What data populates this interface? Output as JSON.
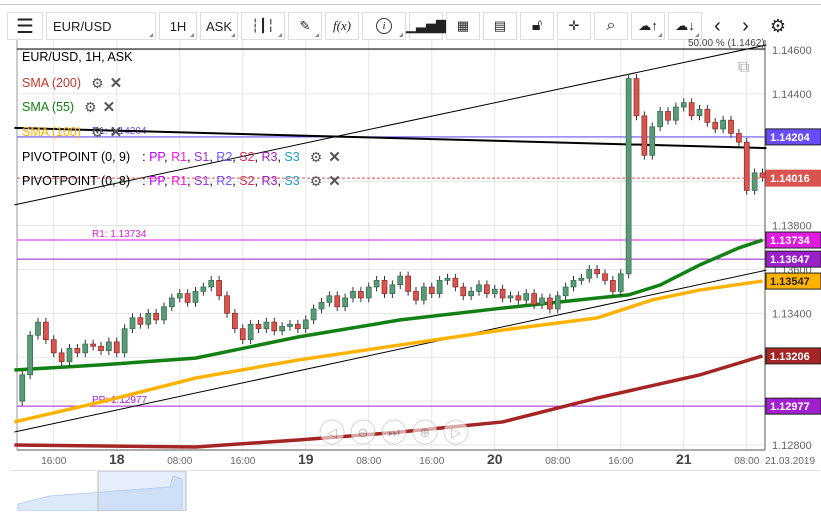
{
  "toolbar": {
    "menu_icon": "hamburger-icon",
    "symbol": "EUR/USD",
    "timeframe": "1H",
    "price_type": "ASK",
    "icons": [
      "candles-icon",
      "pencil-icon",
      "function-icon",
      "info-icon",
      "bar-chart-icon",
      "calendar-icon",
      "news-icon",
      "lock-icon",
      "crosshair-icon",
      "zoom-icon",
      "upload-cloud-icon",
      "download-cloud-icon",
      "chevron-left-icon",
      "chevron-right-icon",
      "gear-icon"
    ],
    "function_label": "f(x)"
  },
  "legend": {
    "title": "EUR/USD, 1H, ASK",
    "sma200": "SMA (200)",
    "sma55": "SMA (55)",
    "sma100": "SMA (100)",
    "pivot1": "PIVOTPOINT (0, 9)",
    "pivot2": "PIVOTPOINT (0, 8)",
    "pivot_parts": [
      {
        "t": "PP",
        "c": "#c000ff"
      },
      {
        "t": "R1",
        "c": "#ff1ad9"
      },
      {
        "t": "S1",
        "c": "#9b30d9"
      },
      {
        "t": "R2",
        "c": "#6a5cff"
      },
      {
        "t": "S2",
        "c": "#d62f5a"
      },
      {
        "t": "R3",
        "c": "#a020c0"
      },
      {
        "t": "S3",
        "c": "#1fa0c0"
      }
    ]
  },
  "fib_label": "50.00 % (1.1462)",
  "chart_data": {
    "type": "candlestick",
    "start": "2019-03-17 12:00",
    "interval_hours": 1,
    "first_open": 1.13,
    "close": [
      1.1312,
      1.133,
      1.1336,
      1.1328,
      1.1322,
      1.1318,
      1.1324,
      1.1322,
      1.1326,
      1.1325,
      1.1323,
      1.1327,
      1.1322,
      1.1333,
      1.1338,
      1.1335,
      1.134,
      1.1337,
      1.1343,
      1.1347,
      1.1349,
      1.1345,
      1.135,
      1.1352,
      1.1355,
      1.1348,
      1.134,
      1.1333,
      1.1328,
      1.1335,
      1.1333,
      1.1336,
      1.1332,
      1.1334,
      1.1335,
      1.1333,
      1.1337,
      1.1342,
      1.1345,
      1.1348,
      1.1343,
      1.1347,
      1.135,
      1.1347,
      1.1352,
      1.1355,
      1.1349,
      1.1353,
      1.1357,
      1.135,
      1.1346,
      1.1352,
      1.1349,
      1.1355,
      1.1356,
      1.1352,
      1.1348,
      1.135,
      1.1353,
      1.1349,
      1.1351,
      1.1347,
      1.1348,
      1.1346,
      1.1349,
      1.1344,
      1.1347,
      1.1342,
      1.1348,
      1.1352,
      1.1355,
      1.1356,
      1.136,
      1.1358,
      1.1355,
      1.135,
      1.1358,
      1.1447,
      1.143,
      1.1412,
      1.1425,
      1.1432,
      1.1428,
      1.1434,
      1.1436,
      1.143,
      1.1433,
      1.1427,
      1.1424,
      1.1428,
      1.1422,
      1.1418,
      1.1396,
      1.1404,
      1.1402
    ],
    "ylim": [
      1.128,
      1.146
    ],
    "y_ticks": [
      1.128,
      1.13,
      1.132,
      1.134,
      1.136,
      1.138,
      1.14,
      1.142,
      1.144,
      1.146
    ],
    "x_ticks": [
      {
        "t": "2019-03-17 16:00",
        "label": "16:00",
        "bold": false
      },
      {
        "t": "2019-03-18 00:00",
        "label": "18",
        "bold": true
      },
      {
        "t": "2019-03-18 08:00",
        "label": "08:00",
        "bold": false
      },
      {
        "t": "2019-03-18 16:00",
        "label": "16:00",
        "bold": false
      },
      {
        "t": "2019-03-19 00:00",
        "label": "19",
        "bold": true
      },
      {
        "t": "2019-03-19 08:00",
        "label": "08:00",
        "bold": false
      },
      {
        "t": "2019-03-19 16:00",
        "label": "16:00",
        "bold": false
      },
      {
        "t": "2019-03-20 00:00",
        "label": "20",
        "bold": true
      },
      {
        "t": "2019-03-20 08:00",
        "label": "08:00",
        "bold": false
      },
      {
        "t": "2019-03-20 16:00",
        "label": "16:00",
        "bold": false
      },
      {
        "t": "2019-03-21 00:00",
        "label": "21",
        "bold": true
      },
      {
        "t": "2019-03-21 08:00",
        "label": "08:00",
        "bold": false
      }
    ],
    "date_label": "21.03.2019",
    "series": [
      {
        "name": "SMA (200)",
        "color": "#a52424",
        "points": [
          [
            "2019-03-17 11:00",
            1.128
          ],
          [
            "2019-03-18 10:00",
            1.12791
          ],
          [
            "2019-03-18 23:00",
            1.12823
          ],
          [
            "2019-03-19 12:00",
            1.12859
          ],
          [
            "2019-03-20 01:00",
            1.12905
          ],
          [
            "2019-03-20 13:00",
            1.13014
          ],
          [
            "2019-03-21 02:00",
            1.13119
          ],
          [
            "2019-03-21 10:00",
            1.13206
          ]
        ],
        "last": "1.13206"
      },
      {
        "name": "SMA (100)",
        "color": "#ffb300",
        "points": [
          [
            "2019-03-17 11:00",
            1.12905
          ],
          [
            "2019-03-17 22:00",
            1.12996
          ],
          [
            "2019-03-18 10:00",
            1.13105
          ],
          [
            "2019-03-18 23:00",
            1.13187
          ],
          [
            "2019-03-19 12:00",
            1.13256
          ],
          [
            "2019-03-20 01:00",
            1.13324
          ],
          [
            "2019-03-20 13:00",
            1.13379
          ],
          [
            "2019-03-20 20:00",
            1.13461
          ],
          [
            "2019-03-21 02:00",
            1.13506
          ],
          [
            "2019-03-21 10:00",
            1.13547
          ]
        ],
        "last": "1.13547"
      },
      {
        "name": "SMA (55)",
        "color": "#128012",
        "points": [
          [
            "2019-03-17 11:00",
            1.13142
          ],
          [
            "2019-03-17 22:00",
            1.13165
          ],
          [
            "2019-03-18 10:00",
            1.13196
          ],
          [
            "2019-03-18 23:00",
            1.13292
          ],
          [
            "2019-03-19 12:00",
            1.1337
          ],
          [
            "2019-03-20 01:00",
            1.13424
          ],
          [
            "2019-03-20 13:00",
            1.1347
          ],
          [
            "2019-03-20 17:00",
            1.13484
          ],
          [
            "2019-03-20 21:00",
            1.13529
          ],
          [
            "2019-03-21 02:00",
            1.1362
          ],
          [
            "2019-03-21 07:00",
            1.13698
          ],
          [
            "2019-03-21 10:00",
            1.13734
          ]
        ]
      }
    ],
    "trendlines": [
      {
        "from": [
          "2019-03-17 11:00",
          1.13894
        ],
        "to": [
          "2019-03-21 10:30",
          1.14623
        ],
        "width": 1
      },
      {
        "from": [
          "2019-03-17 11:00",
          1.14245
        ],
        "to": [
          "2019-03-21 10:30",
          1.14153
        ],
        "width": 2
      },
      {
        "from": [
          "2019-03-17 11:00",
          1.12859
        ],
        "to": [
          "2019-03-21 10:30",
          1.13597
        ],
        "width": 1
      }
    ],
    "levels": [
      {
        "value": 1.14204,
        "label": "1.14204",
        "line_label": "R1: 1.14204",
        "color": "#6a4cff"
      },
      {
        "value": 1.13734,
        "label": "1.13734",
        "line_label": "R1: 1.13734",
        "color": "#e01be0"
      },
      {
        "value": 1.13647,
        "label": "1.13647",
        "line_label": "",
        "color": "#9b1fc9"
      },
      {
        "value": 1.12977,
        "label": "1.12977",
        "line_label": "PP: 1.12977",
        "color": "#a020d0"
      }
    ],
    "current_price": {
      "value": 1.14016,
      "label": "1.14016",
      "color": "#d9534f"
    },
    "up_color": "#5a9a78",
    "down_color": "#d9534f"
  },
  "nav_controls": [
    "scroll-left-icon",
    "zoom-out-icon",
    "scroll-end-icon",
    "zoom-in-icon",
    "scroll-right-icon"
  ]
}
